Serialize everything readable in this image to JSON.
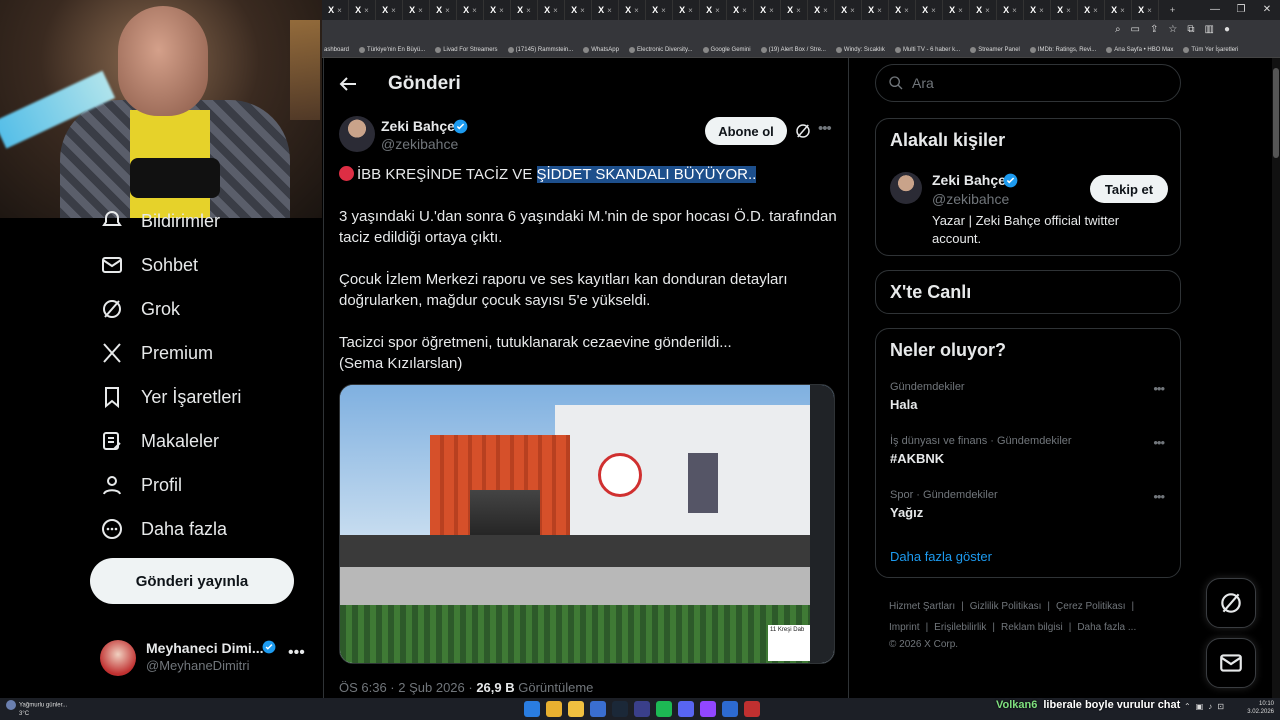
{
  "browser": {
    "tab_label": "X",
    "window_controls": [
      "—",
      "❐",
      "✕"
    ],
    "bookmarks": [
      "ashboard",
      "Türkiye'nin En Büyü...",
      "Livad For Streamers",
      "(17145) Rammstein...",
      "WhatsApp",
      "Electronic Diversity...",
      "Google Gemini",
      "(19) Alert Box / Stre...",
      "Windy: Sıcaklık",
      "Multi TV - 6 haber k...",
      "Streamer Panel",
      "IMDb: Ratings, Revi...",
      "Ana Sayfa • HBO Max",
      "Tüm Yer İşaretleri"
    ]
  },
  "nav": {
    "items": [
      {
        "label": "Bildirimler"
      },
      {
        "label": "Sohbet"
      },
      {
        "label": "Grok"
      },
      {
        "label": "Premium"
      },
      {
        "label": "Yer İşaretleri"
      },
      {
        "label": "Makaleler"
      },
      {
        "label": "Profil"
      },
      {
        "label": "Daha fazla"
      }
    ],
    "post_button": "Gönderi yayınla",
    "user": {
      "name": "Meyhaneci Dimi...",
      "handle": "@MeyhaneDimitri",
      "more": "•••"
    }
  },
  "post": {
    "header_title": "Gönderi",
    "author_name": "Zeki Bahçe",
    "author_handle": "@zekibahce",
    "subscribe_label": "Abone ol",
    "more": "•••",
    "text_headline_plain": "İBB KREŞİNDE TACİZ VE ",
    "text_headline_highlight": "ŞİDDET SKANDALI BÜYÜYOR..",
    "text_p1": "3 yaşındaki U.'dan sonra 6 yaşındaki M.'nin de spor hocası Ö.D. tarafından taciz edildiği ortaya çıktı.",
    "text_p2": "Çocuk İzlem Merkezi raporu ve ses kayıtları kan donduran detayları doğrularken, mağdur çocuk sayısı 5'e yükseldi.",
    "text_p3_line1": "Tacizci spor öğretmeni, tutuklanarak cezaevine gönderildi...",
    "text_p3_line2": "(Sema Kızılarslan)",
    "image_sign_text": "11 Kreşi Dab",
    "meta_time": "ÖS 6:36 · 2 Şub 2026 · ",
    "meta_views": "26,9 B",
    "meta_views_label": " Görüntüleme"
  },
  "right": {
    "search_placeholder": "Ara",
    "related_title": "Alakalı kişiler",
    "related_user": {
      "name": "Zeki Bahçe",
      "handle": "@zekibahce",
      "bio": "Yazar | Zeki Bahçe official twitter account.",
      "follow_label": "Takip et"
    },
    "live_title": "X'te Canlı",
    "trends_title": "Neler oluyor?",
    "trends": [
      {
        "context": "Gündemdekiler",
        "title": "Hala"
      },
      {
        "context": "İş dünyası ve finans · Gündemdekiler",
        "title": "#AKBNK"
      },
      {
        "context": "Spor · Gündemdekiler",
        "title": "Yağız"
      }
    ],
    "trend_more": "•••",
    "show_more": "Daha fazla göster",
    "footer": {
      "links_row1": [
        "Hizmet Şartları",
        "Gizlilik Politikası",
        "Çerez Politikası"
      ],
      "links_row2": [
        "Imprint",
        "Erişilebilirlik",
        "Reklam bilgisi",
        "Daha fazla ..."
      ],
      "copyright": "© 2026 X Corp."
    }
  },
  "taskbar": {
    "weather_line1": "Yağmurlu günler...",
    "weather_line2": "3°C",
    "chat_user": "Volkan6",
    "chat_message": "liberale boyle vurulur chat",
    "time": "10:10",
    "date": "3.02.2026"
  },
  "colors": {
    "accent": "#1d9bf0",
    "highlight": "#1d4f8c",
    "verified": "#1d9bf0",
    "alert_dot": "#dd2e44"
  }
}
